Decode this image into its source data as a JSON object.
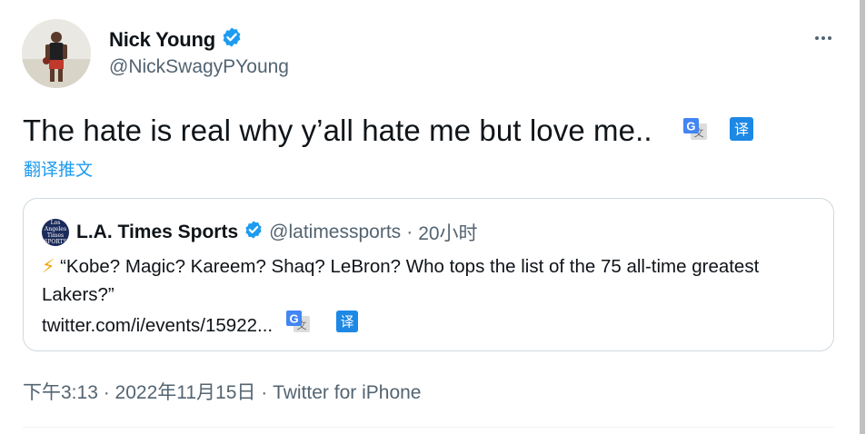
{
  "author": {
    "name": "Nick Young",
    "handle": "@NickSwagyPYoung",
    "verified": true
  },
  "tweet": {
    "text": "The hate is real why y’all hate me but love me..",
    "translate_label": "翻译推文"
  },
  "quote": {
    "avatar_text": "Los Angeles Times SPORTS",
    "name": "L.A. Times Sports",
    "handle": "@latimessports",
    "separator": "·",
    "time": "20小时",
    "emoji": "⚡",
    "text": " “Kobe? Magic? Kareem? Shaq? LeBron? Who tops the list of the 75 all-time greatest Lakers?”",
    "link": "twitter.com/i/events/15922..."
  },
  "footer": {
    "timestamp": "下午3:13 · 2022年11月15日 · Twitter for iPhone"
  },
  "icons": {
    "verified": "verified-badge-icon",
    "more": "more-icon",
    "google_translate": "google-translate-icon",
    "youdao_translate": "yi-translate-icon"
  },
  "colors": {
    "accent": "#1d9bf0",
    "secondary_text": "#536471",
    "primary_text": "#0f1419",
    "border": "#cfd9de"
  }
}
